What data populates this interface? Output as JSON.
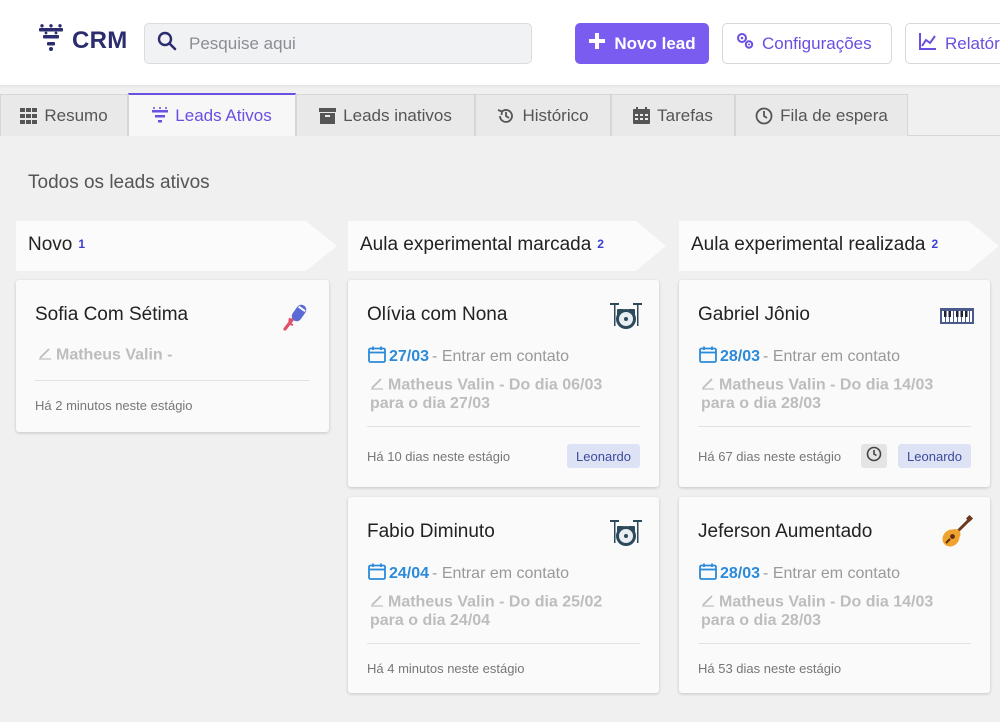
{
  "header": {
    "logo_text": "CRM",
    "search_placeholder": "Pesquise aqui",
    "new_lead_label": "Novo lead",
    "config_label": "Configurações",
    "reports_label": "Relatór"
  },
  "tabs": [
    {
      "label": "Resumo",
      "icon": "grid-icon"
    },
    {
      "label": "Leads Ativos",
      "icon": "funnel-icon",
      "active": true
    },
    {
      "label": "Leads inativos",
      "icon": "archive-icon"
    },
    {
      "label": "Histórico",
      "icon": "history-icon"
    },
    {
      "label": "Tarefas",
      "icon": "calendar-icon"
    },
    {
      "label": "Fila de espera",
      "icon": "clock-icon"
    }
  ],
  "section_title": "Todos os leads ativos",
  "colors": {
    "accent": "#7b5cf0",
    "accent_text": "#6a4fe0",
    "date": "#2b8ad9",
    "badge_bg": "#dde3f5"
  },
  "columns": [
    {
      "title": "Novo",
      "count": "1",
      "cards": [
        {
          "name": "Sofia Com Sétima",
          "instrument": "microphone-icon",
          "author": "Matheus Valin -",
          "footer": "Há 2 minutos neste estágio"
        }
      ]
    },
    {
      "title": "Aula experimental marcada",
      "count": "2",
      "cards": [
        {
          "name": "Olívia com Nona",
          "instrument": "drums-icon",
          "date": "27/03",
          "action": " - Entrar em contato",
          "author": "Matheus Valin - Do dia 06/03 para o dia 27/03",
          "footer": "Há 10 dias neste estágio",
          "badge": "Leonardo"
        },
        {
          "name": "Fabio Diminuto",
          "instrument": "drums-icon",
          "date": "24/04",
          "action": " - Entrar em contato",
          "author": "Matheus Valin - Do dia 25/02 para o dia 24/04",
          "footer": "Há 4 minutos neste estágio"
        }
      ]
    },
    {
      "title": "Aula experimental realizada",
      "count": "2",
      "cards": [
        {
          "name": "Gabriel Jônio",
          "instrument": "keyboard-icon",
          "date": "28/03",
          "action": " - Entrar em contato",
          "author": "Matheus Valin - Do dia 14/03 para o dia 28/03",
          "footer": "Há 67 dias neste estágio",
          "badge": "Leonardo"
        },
        {
          "name": "Jeferson Aumentado",
          "instrument": "guitar-icon",
          "date": "28/03",
          "action": " - Entrar em contato",
          "author": "Matheus Valin - Do dia 14/03 para o dia 28/03",
          "footer": "Há 53 dias neste estágio"
        }
      ]
    }
  ]
}
